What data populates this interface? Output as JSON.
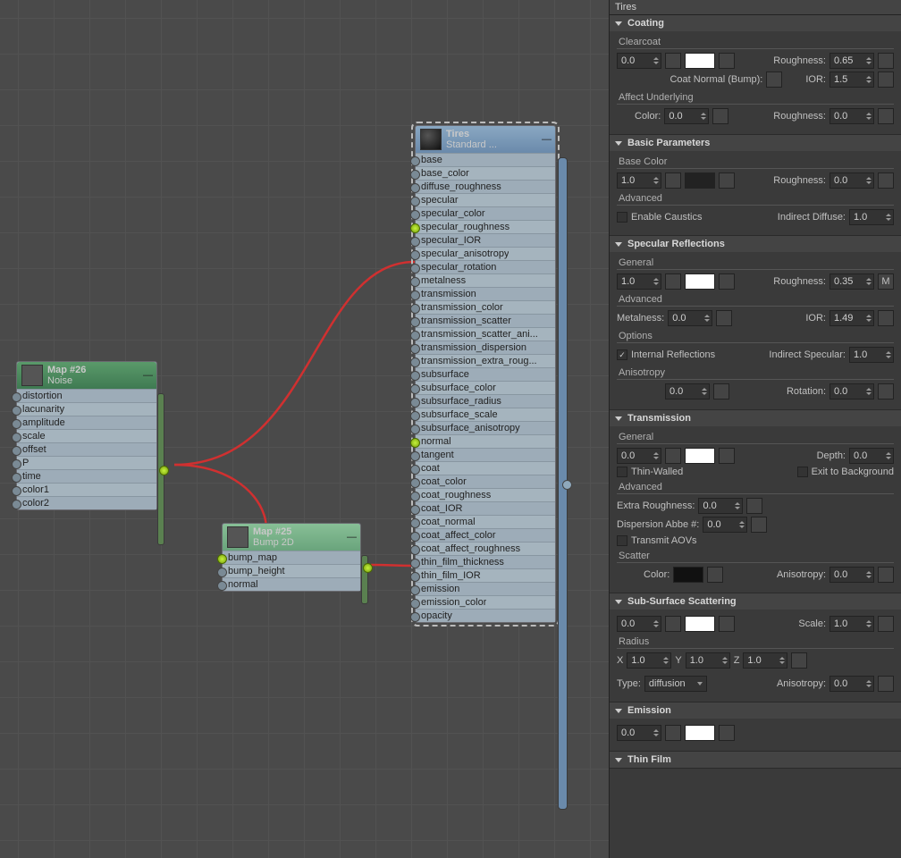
{
  "panelTitle": "Tires",
  "sections": {
    "coating": {
      "title": "Coating",
      "clearcoat_lbl": "Clearcoat",
      "clearcoat": "0.0",
      "rough_lbl": "Roughness:",
      "rough": "0.65",
      "swatch": "#ffffff",
      "normal_lbl": "Coat Normal (Bump):",
      "ior_lbl": "IOR:",
      "ior": "1.5",
      "affect_lbl": "Affect Underlying",
      "color_lbl": "Color:",
      "color": "0.0",
      "rough2_lbl": "Roughness:",
      "rough2": "0.0"
    },
    "basic": {
      "title": "Basic Parameters",
      "basecolor_lbl": "Base Color",
      "val": "1.0",
      "swatch": "#222222",
      "rough_lbl": "Roughness:",
      "rough": "0.0",
      "adv_lbl": "Advanced",
      "caustics_lbl": "Enable Caustics",
      "indirect_lbl": "Indirect Diffuse:",
      "indirect": "1.0"
    },
    "specular": {
      "title": "Specular Reflections",
      "gen_lbl": "General",
      "val": "1.0",
      "swatch": "#ffffff",
      "rough_lbl": "Roughness:",
      "rough": "0.35",
      "adv_lbl": "Advanced",
      "metal_lbl": "Metalness:",
      "metal": "0.0",
      "ior_lbl": "IOR:",
      "ior": "1.49",
      "opt_lbl": "Options",
      "intref_lbl": "Internal Reflections",
      "indspec_lbl": "Indirect Specular:",
      "indspec": "1.0",
      "aniso_lbl": "Anisotropy",
      "aniso": "0.0",
      "rot_lbl": "Rotation:",
      "rot": "0.0"
    },
    "transmission": {
      "title": "Transmission",
      "gen_lbl": "General",
      "val": "0.0",
      "swatch": "#ffffff",
      "depth_lbl": "Depth:",
      "depth": "0.0",
      "thin_lbl": "Thin-Walled",
      "exit_lbl": "Exit to Background",
      "adv_lbl": "Advanced",
      "extra_lbl": "Extra Roughness:",
      "extra": "0.0",
      "abbe_lbl": "Dispersion Abbe #:",
      "abbe": "0.0",
      "aov_lbl": "Transmit AOVs",
      "scatter_lbl": "Scatter",
      "color_lbl": "Color:",
      "swatch2": "#111111",
      "aniso_lbl": "Anisotropy:",
      "aniso": "0.0"
    },
    "sss": {
      "title": "Sub-Surface Scattering",
      "val": "0.0",
      "swatch": "#ffffff",
      "scale_lbl": "Scale:",
      "scale": "1.0",
      "radius_lbl": "Radius",
      "x_lbl": "X",
      "x": "1.0",
      "y_lbl": "Y",
      "y": "1.0",
      "z_lbl": "Z",
      "z": "1.0",
      "type_lbl": "Type:",
      "type": "diffusion",
      "aniso_lbl": "Anisotropy:",
      "aniso": "0.0"
    },
    "emission": {
      "title": "Emission",
      "val": "0.0",
      "swatch": "#ffffff"
    },
    "thinfilm": {
      "title": "Thin Film"
    }
  },
  "nodes": {
    "noise": {
      "title": "Map #26",
      "sub": "Noise",
      "slots": [
        "distortion",
        "lacunarity",
        "amplitude",
        "scale",
        "offset",
        "P",
        "time",
        "color1",
        "color2"
      ]
    },
    "bump": {
      "title": "Map #25",
      "sub": "Bump 2D",
      "slots": [
        "bump_map",
        "bump_height",
        "normal"
      ]
    },
    "tires": {
      "title": "Tires",
      "sub": "Standard ...",
      "slots": [
        "base",
        "base_color",
        "diffuse_roughness",
        "specular",
        "specular_color",
        "specular_roughness",
        "specular_IOR",
        "specular_anisotropy",
        "specular_rotation",
        "metalness",
        "transmission",
        "transmission_color",
        "transmission_scatter",
        "transmission_scatter_ani...",
        "transmission_dispersion",
        "transmission_extra_roug...",
        "subsurface",
        "subsurface_color",
        "subsurface_radius",
        "subsurface_scale",
        "subsurface_anisotropy",
        "normal",
        "tangent",
        "coat",
        "coat_color",
        "coat_roughness",
        "coat_IOR",
        "coat_normal",
        "coat_affect_color",
        "coat_affect_roughness",
        "thin_film_thickness",
        "thin_film_IOR",
        "emission",
        "emission_color",
        "opacity"
      ]
    }
  }
}
